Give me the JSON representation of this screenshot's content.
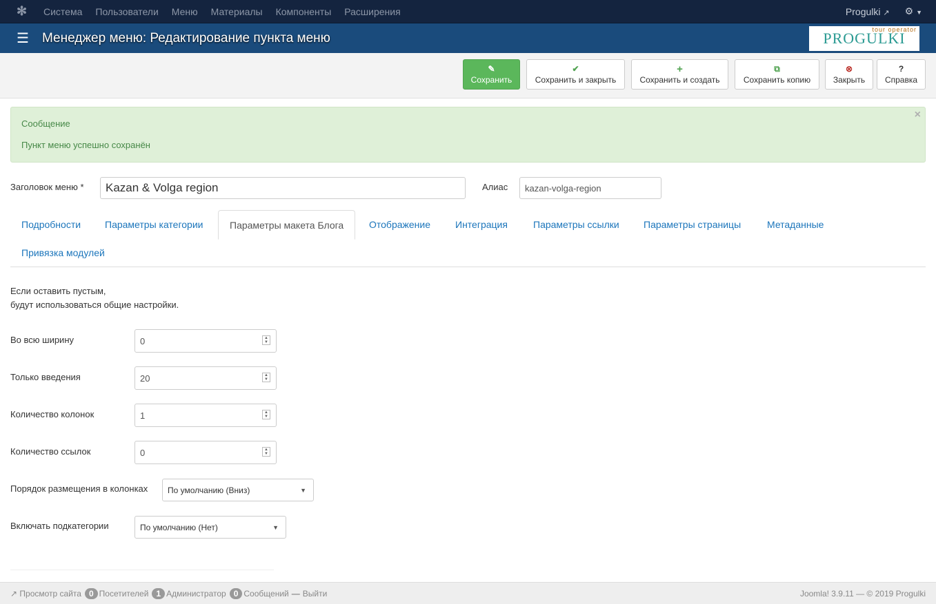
{
  "topnav": {
    "items": [
      "Система",
      "Пользователи",
      "Меню",
      "Материалы",
      "Компоненты",
      "Расширения"
    ],
    "site": "Progulki"
  },
  "header": {
    "title": "Менеджер меню: Редактирование пункта меню",
    "logo_text": "PROGULKI",
    "logo_tag": "tour operator"
  },
  "toolbar": {
    "save": "Сохранить",
    "save_close": "Сохранить и закрыть",
    "save_new": "Сохранить и создать",
    "save_copy": "Сохранить копию",
    "close": "Закрыть",
    "help": "Справка"
  },
  "alert": {
    "heading": "Сообщение",
    "message": "Пункт меню успешно сохранён"
  },
  "form": {
    "title_label": "Заголовок меню *",
    "title_value": "Kazan & Volga region",
    "alias_label": "Алиас",
    "alias_value": "kazan-volga-region"
  },
  "tabs": [
    "Подробности",
    "Параметры категории",
    "Параметры макета Блога",
    "Отображение",
    "Интеграция",
    "Параметры ссылки",
    "Параметры страницы",
    "Метаданные",
    "Привязка модулей"
  ],
  "blog": {
    "note1": "Если оставить пустым,",
    "note2": "будут использоваться общие настройки.",
    "fields": [
      {
        "label": "Во всю ширину",
        "value": "0"
      },
      {
        "label": "Только введения",
        "value": "20"
      },
      {
        "label": "Количество колонок",
        "value": "1"
      },
      {
        "label": "Количество ссылок",
        "value": "0"
      }
    ],
    "order_label": "Порядок размещения в колонках",
    "order_value": "По умолчанию (Вниз)",
    "subcat_label": "Включать подкатегории",
    "subcat_value": "По умолчанию (Нет)"
  },
  "footer": {
    "view_site": "Просмотр сайта",
    "visitors_count": "0",
    "visitors": "Посетителей",
    "admins_count": "1",
    "admins": "Администратор",
    "messages_count": "0",
    "messages": "Сообщений",
    "logout": "Выйти",
    "version": "Joomla! 3.9.11  —  © 2019 Progulki"
  }
}
